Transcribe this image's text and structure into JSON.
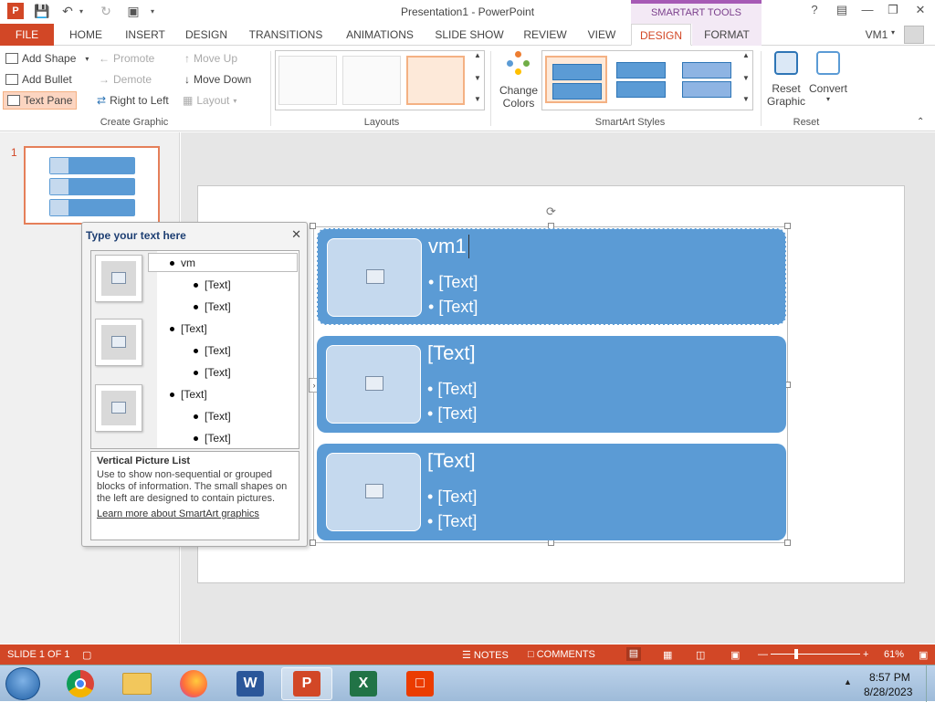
{
  "window": {
    "title": "Presentation1 - PowerPoint",
    "context_tab": "SMARTART TOOLS",
    "help": "?",
    "user": "VM1"
  },
  "tabs": [
    "HOME",
    "INSERT",
    "DESIGN",
    "TRANSITIONS",
    "ANIMATIONS",
    "SLIDE SHOW",
    "REVIEW",
    "VIEW",
    "DESIGN",
    "FORMAT"
  ],
  "file_tab": "FILE",
  "ribbon": {
    "create_graphic": {
      "add_shape": "Add Shape",
      "add_bullet": "Add Bullet",
      "text_pane": "Text Pane",
      "promote": "Promote",
      "demote": "Demote",
      "right_to_left": "Right to Left",
      "move_up": "Move Up",
      "move_down": "Move Down",
      "layout": "Layout",
      "group_label": "Create Graphic"
    },
    "layouts_label": "Layouts",
    "change_colors": [
      "Change",
      "Colors"
    ],
    "styles_label": "SmartArt Styles",
    "reset_graphic": [
      "Reset",
      "Graphic"
    ],
    "convert": "Convert",
    "reset_label": "Reset"
  },
  "thumbnail": {
    "number": "1"
  },
  "smartart": {
    "rows": [
      {
        "heading": "vm1",
        "bullets": [
          "[Text]",
          "[Text]"
        ]
      },
      {
        "heading": "[Text]",
        "bullets": [
          "[Text]",
          "[Text]"
        ]
      },
      {
        "heading": "[Text]",
        "bullets": [
          "[Text]",
          "[Text]"
        ]
      }
    ]
  },
  "text_pane": {
    "title": "Type your text here",
    "items": [
      {
        "level": 1,
        "text": "vm"
      },
      {
        "level": 2,
        "text": "[Text]"
      },
      {
        "level": 2,
        "text": "[Text]"
      },
      {
        "level": 1,
        "text": "[Text]"
      },
      {
        "level": 2,
        "text": "[Text]"
      },
      {
        "level": 2,
        "text": "[Text]"
      },
      {
        "level": 1,
        "text": "[Text]"
      },
      {
        "level": 2,
        "text": "[Text]"
      },
      {
        "level": 2,
        "text": "[Text]"
      }
    ],
    "desc_title": "Vertical Picture List",
    "desc_body": "Use to show non-sequential or grouped blocks of information. The small shapes on the left are designed to contain pictures.",
    "desc_link": "Learn more about SmartArt graphics"
  },
  "status": {
    "slide": "SLIDE 1 OF 1",
    "notes": "NOTES",
    "comments": "COMMENTS",
    "zoom": "61%"
  },
  "taskbar": {
    "time": "8:57 PM",
    "date": "8/28/2023"
  },
  "colors": {
    "accent": "#d24726",
    "smartart_fill": "#5b9bd5",
    "context": "#a65ab5"
  }
}
